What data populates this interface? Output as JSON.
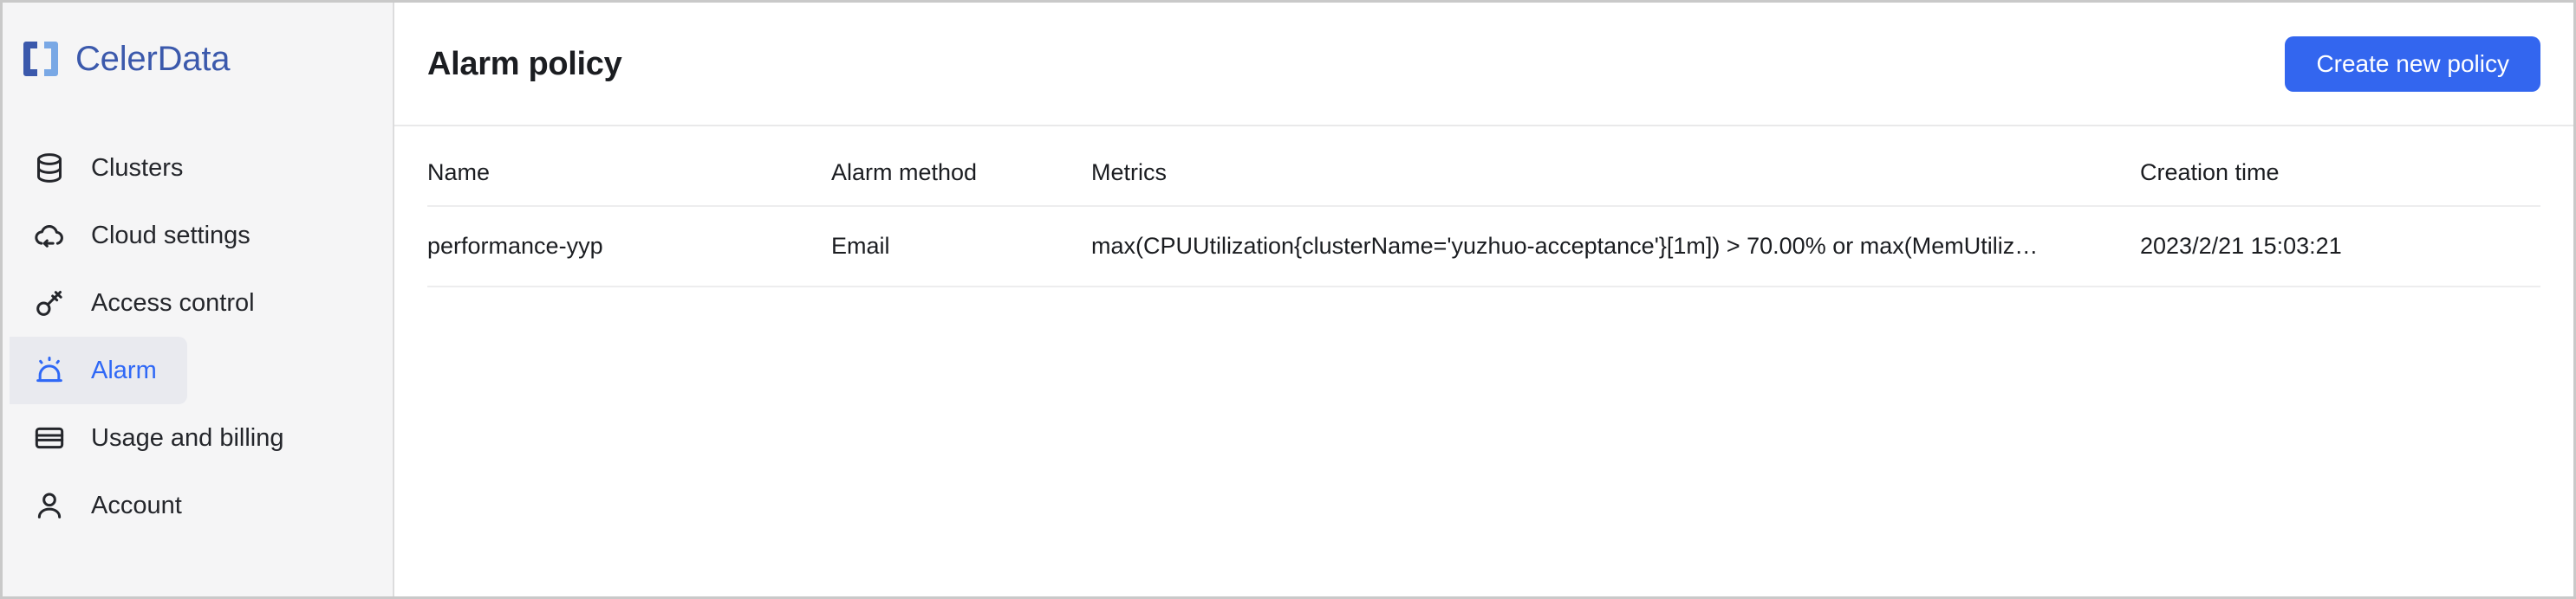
{
  "brand": {
    "name": "CelerData",
    "logo_icon": "celerdata-bracket-logo",
    "color_dark": "#3b59ac",
    "color_light": "#7fa9e3"
  },
  "sidebar": {
    "items": [
      {
        "label": "Clusters",
        "icon": "database-icon",
        "active": false
      },
      {
        "label": "Cloud settings",
        "icon": "cloud-sync-icon",
        "active": false
      },
      {
        "label": "Access control",
        "icon": "key-icon",
        "active": false
      },
      {
        "label": "Alarm",
        "icon": "alarm-siren-icon",
        "active": true
      },
      {
        "label": "Usage and billing",
        "icon": "credit-card-icon",
        "active": false
      },
      {
        "label": "Account",
        "icon": "user-icon",
        "active": false
      }
    ],
    "active_color": "#2f68f6",
    "active_background": "#e9eaef"
  },
  "header": {
    "title": "Alarm policy",
    "create_button_label": "Create new policy",
    "create_button_color": "#3366ef"
  },
  "table": {
    "columns": [
      "Name",
      "Alarm method",
      "Metrics",
      "Creation time"
    ],
    "rows": [
      {
        "name": "performance-yyp",
        "alarm_method": "Email",
        "metrics": "max(CPUUtilization{clusterName='yuzhuo-acceptance'}[1m]) > 70.00% or max(MemUtiliz…",
        "creation_time": "2023/2/21 15:03:21"
      }
    ]
  }
}
